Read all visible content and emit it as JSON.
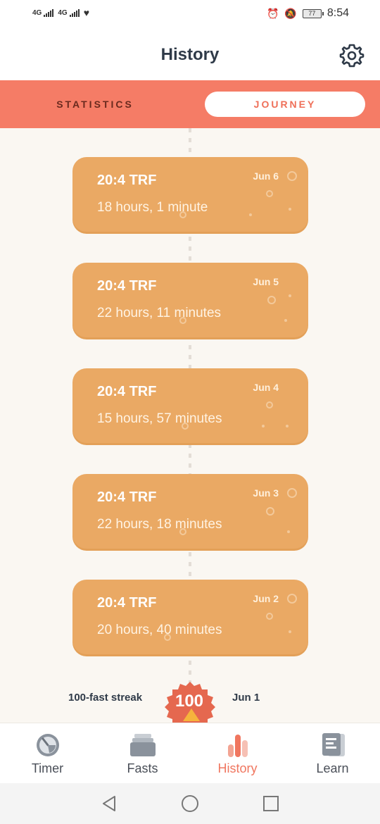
{
  "status_bar": {
    "network_1": "4G",
    "network_2": "4G",
    "battery": "77",
    "time": "8:54"
  },
  "header": {
    "title": "History"
  },
  "tabs": [
    {
      "label": "STATISTICS",
      "active": false
    },
    {
      "label": "JOURNEY",
      "active": true
    }
  ],
  "entries": [
    {
      "plan": "20:4 TRF",
      "duration": "18 hours, 1 minute",
      "date": "Jun 6"
    },
    {
      "plan": "20:4 TRF",
      "duration": "22 hours, 11 minutes",
      "date": "Jun 5"
    },
    {
      "plan": "20:4 TRF",
      "duration": "15 hours, 57 minutes",
      "date": "Jun 4"
    },
    {
      "plan": "20:4 TRF",
      "duration": "22 hours, 18 minutes",
      "date": "Jun 3"
    },
    {
      "plan": "20:4 TRF",
      "duration": "20 hours, 40 minutes",
      "date": "Jun 2"
    }
  ],
  "streak": {
    "label": "100-fast streak",
    "badge_value": "100",
    "date": "Jun 1"
  },
  "bottom_nav": [
    {
      "label": "Timer",
      "icon": "timer-icon",
      "active": false
    },
    {
      "label": "Fasts",
      "icon": "fasts-icon",
      "active": false
    },
    {
      "label": "History",
      "icon": "history-icon",
      "active": true
    },
    {
      "label": "Learn",
      "icon": "learn-icon",
      "active": false
    }
  ],
  "colors": {
    "accent": "#f57c66",
    "card": "#eaa964",
    "active_nav": "#f0765f",
    "inactive_nav": "#8a929c"
  }
}
